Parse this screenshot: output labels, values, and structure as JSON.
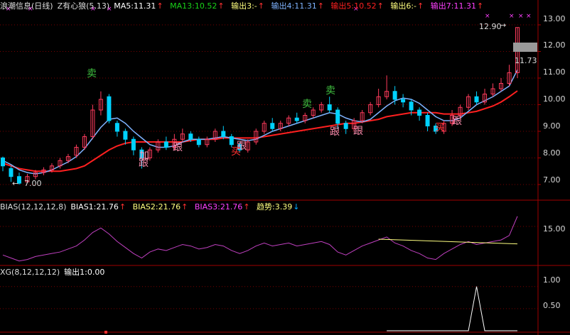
{
  "colors": {
    "bg": "#000000",
    "grid": "#7a0000",
    "frame": "#a00000",
    "up": "#ff3b5c",
    "down": "#00d2ff",
    "ma5": "#ffffff",
    "ma13": "#19d219",
    "out3": "#ffff7f",
    "out4": "#7fb3ff",
    "out5": "#ff2020",
    "out6": "#ffff7f",
    "out7": "#ff40ff",
    "bias": "#c040c0",
    "trend": "#ffff80",
    "xg": "#ffffff",
    "sell": "#3fbf3f",
    "follow": "#ff8fb0",
    "label_pink": "#ff8fc0",
    "arrow_up": "#ff3030",
    "arrow_down": "#00aaff"
  },
  "main_header": {
    "title": "浪潮信息(日线)",
    "indicator": "Z有心狼(5,13)",
    "ma5": "MA5:11.31",
    "ma13": "MA13:10.52",
    "out3": "输出3:-",
    "out4": "输出4:11.31",
    "out5": "输出5:10.52",
    "out6": "输出6:-",
    "out7": "输出7:11.31"
  },
  "bias_header": {
    "name": "BIAS(12,12,12,8)",
    "b1": "BIAS1:21.76",
    "b2": "BIAS2:21.76",
    "b3": "BIAS3:21.76",
    "trend": "趋势:3.39"
  },
  "xg_header": {
    "name": "XG(8,12,12,12)",
    "out1": "输出1:0.00"
  },
  "price_axis": {
    "ticks": [
      "13.00",
      "12.00",
      "11.00",
      "10.00",
      "9.00",
      "8.00",
      "7.00"
    ],
    "high_label": "12.90",
    "low_label": "7.00",
    "last_label": "11.73"
  },
  "bias_axis": {
    "ticks": [
      "15.00"
    ]
  },
  "xg_axis": {
    "ticks": [
      "1.00",
      "0.50"
    ]
  },
  "chart_data": {
    "type": "candlestick",
    "ylim": [
      6.6,
      13.4
    ],
    "candles": [
      [
        8.0,
        7.7,
        8.05,
        7.5
      ],
      [
        7.6,
        7.3,
        7.7,
        7.1
      ],
      [
        7.3,
        7.05,
        7.45,
        7.0
      ],
      [
        7.1,
        7.3,
        7.4,
        7.05
      ],
      [
        7.3,
        7.45,
        7.55,
        7.2
      ],
      [
        7.45,
        7.55,
        7.65,
        7.35
      ],
      [
        7.55,
        7.7,
        7.8,
        7.45
      ],
      [
        7.7,
        7.9,
        8.0,
        7.6
      ],
      [
        7.9,
        8.05,
        8.15,
        7.8
      ],
      [
        8.1,
        8.4,
        8.5,
        8.0
      ],
      [
        8.4,
        8.8,
        8.9,
        8.3
      ],
      [
        8.8,
        9.8,
        10.0,
        8.7
      ],
      [
        9.8,
        10.2,
        10.5,
        9.6
      ],
      [
        10.3,
        9.4,
        10.4,
        9.3
      ],
      [
        9.3,
        9.0,
        9.4,
        8.8
      ],
      [
        9.0,
        8.7,
        9.1,
        8.5
      ],
      [
        8.7,
        8.3,
        8.8,
        8.1
      ],
      [
        8.3,
        8.0,
        8.4,
        7.6
      ],
      [
        8.0,
        8.3,
        8.4,
        7.9
      ],
      [
        8.3,
        8.6,
        8.7,
        8.2
      ],
      [
        8.6,
        8.4,
        8.8,
        8.3
      ],
      [
        8.4,
        8.7,
        8.9,
        8.3
      ],
      [
        8.7,
        8.9,
        9.1,
        8.6
      ],
      [
        8.9,
        8.7,
        9.0,
        8.6
      ],
      [
        8.7,
        8.5,
        8.8,
        8.4
      ],
      [
        8.5,
        8.7,
        8.8,
        8.4
      ],
      [
        8.7,
        9.0,
        9.1,
        8.6
      ],
      [
        9.0,
        8.8,
        9.2,
        8.7
      ],
      [
        8.8,
        8.5,
        8.9,
        8.4
      ],
      [
        8.5,
        8.3,
        8.6,
        8.2
      ],
      [
        8.3,
        8.6,
        8.7,
        8.2
      ],
      [
        8.6,
        9.0,
        9.1,
        8.5
      ],
      [
        9.0,
        9.3,
        9.4,
        8.9
      ],
      [
        9.3,
        9.1,
        9.5,
        9.0
      ],
      [
        9.1,
        9.3,
        9.4,
        9.0
      ],
      [
        9.3,
        9.5,
        9.6,
        9.2
      ],
      [
        9.5,
        9.4,
        9.7,
        9.3
      ],
      [
        9.4,
        9.6,
        9.7,
        9.3
      ],
      [
        9.6,
        9.8,
        9.9,
        9.5
      ],
      [
        9.8,
        10.0,
        10.1,
        9.7
      ],
      [
        10.0,
        9.8,
        10.3,
        9.7
      ],
      [
        9.8,
        9.3,
        9.9,
        9.1
      ],
      [
        9.3,
        9.1,
        9.4,
        8.9
      ],
      [
        9.1,
        9.4,
        9.5,
        9.0
      ],
      [
        9.4,
        9.7,
        9.8,
        9.3
      ],
      [
        9.7,
        10.0,
        10.1,
        9.6
      ],
      [
        10.0,
        10.3,
        10.6,
        9.9
      ],
      [
        10.3,
        10.5,
        11.1,
        10.2
      ],
      [
        10.5,
        10.2,
        10.7,
        10.0
      ],
      [
        10.2,
        10.1,
        10.4,
        9.9
      ],
      [
        10.1,
        9.8,
        10.2,
        9.6
      ],
      [
        9.8,
        9.6,
        9.9,
        9.4
      ],
      [
        9.6,
        9.2,
        9.7,
        9.0
      ],
      [
        9.2,
        9.0,
        9.3,
        8.9
      ],
      [
        9.0,
        9.3,
        9.4,
        8.9
      ],
      [
        9.3,
        9.6,
        9.8,
        9.2
      ],
      [
        9.6,
        9.9,
        10.0,
        9.5
      ],
      [
        9.9,
        10.3,
        10.4,
        9.8
      ],
      [
        10.3,
        10.1,
        10.5,
        10.0
      ],
      [
        10.1,
        10.4,
        10.6,
        10.0
      ],
      [
        10.4,
        10.6,
        10.8,
        10.3
      ],
      [
        10.6,
        10.8,
        11.0,
        10.5
      ],
      [
        10.8,
        11.2,
        11.5,
        10.7
      ],
      [
        11.2,
        12.9,
        12.9,
        11.0
      ]
    ],
    "ma5": [
      7.9,
      7.75,
      7.55,
      7.45,
      7.4,
      7.45,
      7.55,
      7.7,
      7.85,
      8.05,
      8.35,
      8.75,
      9.15,
      9.45,
      9.5,
      9.3,
      9.0,
      8.75,
      8.5,
      8.4,
      8.4,
      8.45,
      8.6,
      8.7,
      8.7,
      8.7,
      8.75,
      8.8,
      8.75,
      8.7,
      8.65,
      8.7,
      8.85,
      9.0,
      9.1,
      9.2,
      9.3,
      9.4,
      9.5,
      9.6,
      9.7,
      9.65,
      9.5,
      9.4,
      9.35,
      9.45,
      9.7,
      9.95,
      10.15,
      10.25,
      10.2,
      10.05,
      9.8,
      9.55,
      9.4,
      9.4,
      9.5,
      9.75,
      10.0,
      10.15,
      10.3,
      10.5,
      10.7,
      11.31
    ],
    "ma13": [
      7.8,
      7.7,
      7.6,
      7.55,
      7.5,
      7.5,
      7.5,
      7.5,
      7.55,
      7.6,
      7.7,
      7.9,
      8.1,
      8.3,
      8.45,
      8.55,
      8.6,
      8.6,
      8.6,
      8.6,
      8.6,
      8.6,
      8.6,
      8.65,
      8.7,
      8.7,
      8.7,
      8.75,
      8.75,
      8.75,
      8.75,
      8.75,
      8.8,
      8.85,
      8.9,
      8.95,
      9.0,
      9.05,
      9.1,
      9.15,
      9.2,
      9.25,
      9.3,
      9.3,
      9.35,
      9.4,
      9.45,
      9.55,
      9.6,
      9.65,
      9.7,
      9.7,
      9.7,
      9.7,
      9.65,
      9.65,
      9.65,
      9.7,
      9.75,
      9.85,
      9.95,
      10.1,
      10.3,
      10.52
    ],
    "bias": [
      -4,
      -6,
      -8,
      -7,
      -5,
      -4,
      -3,
      -2,
      0,
      2,
      6,
      11,
      14,
      10,
      5,
      1,
      -3,
      -6,
      -2,
      0,
      -1,
      1,
      3,
      2,
      0,
      1,
      3,
      2,
      -1,
      -3,
      -1,
      2,
      4,
      2,
      3,
      4,
      2,
      3,
      4,
      5,
      3,
      -2,
      -4,
      -1,
      2,
      4,
      6,
      8,
      4,
      2,
      -1,
      -3,
      -6,
      -7,
      -3,
      0,
      3,
      5,
      3,
      4,
      5,
      6,
      9,
      21.76
    ],
    "trend": {
      "from_index": 46,
      "from": 6.5,
      "to_index": 63,
      "to": 3.39
    },
    "xg": {
      "spike_index": 58,
      "spike_value": 1.0,
      "start_index": 47,
      "ylim": [
        0,
        1.3
      ]
    }
  },
  "signals": {
    "sell_labels": [
      "卖",
      "卖",
      "卖"
    ],
    "follow_labels": [
      "跟",
      "跟",
      "跟",
      "跟",
      "跟",
      "跟"
    ],
    "buy_labels": [
      "加",
      "买",
      "买"
    ]
  }
}
